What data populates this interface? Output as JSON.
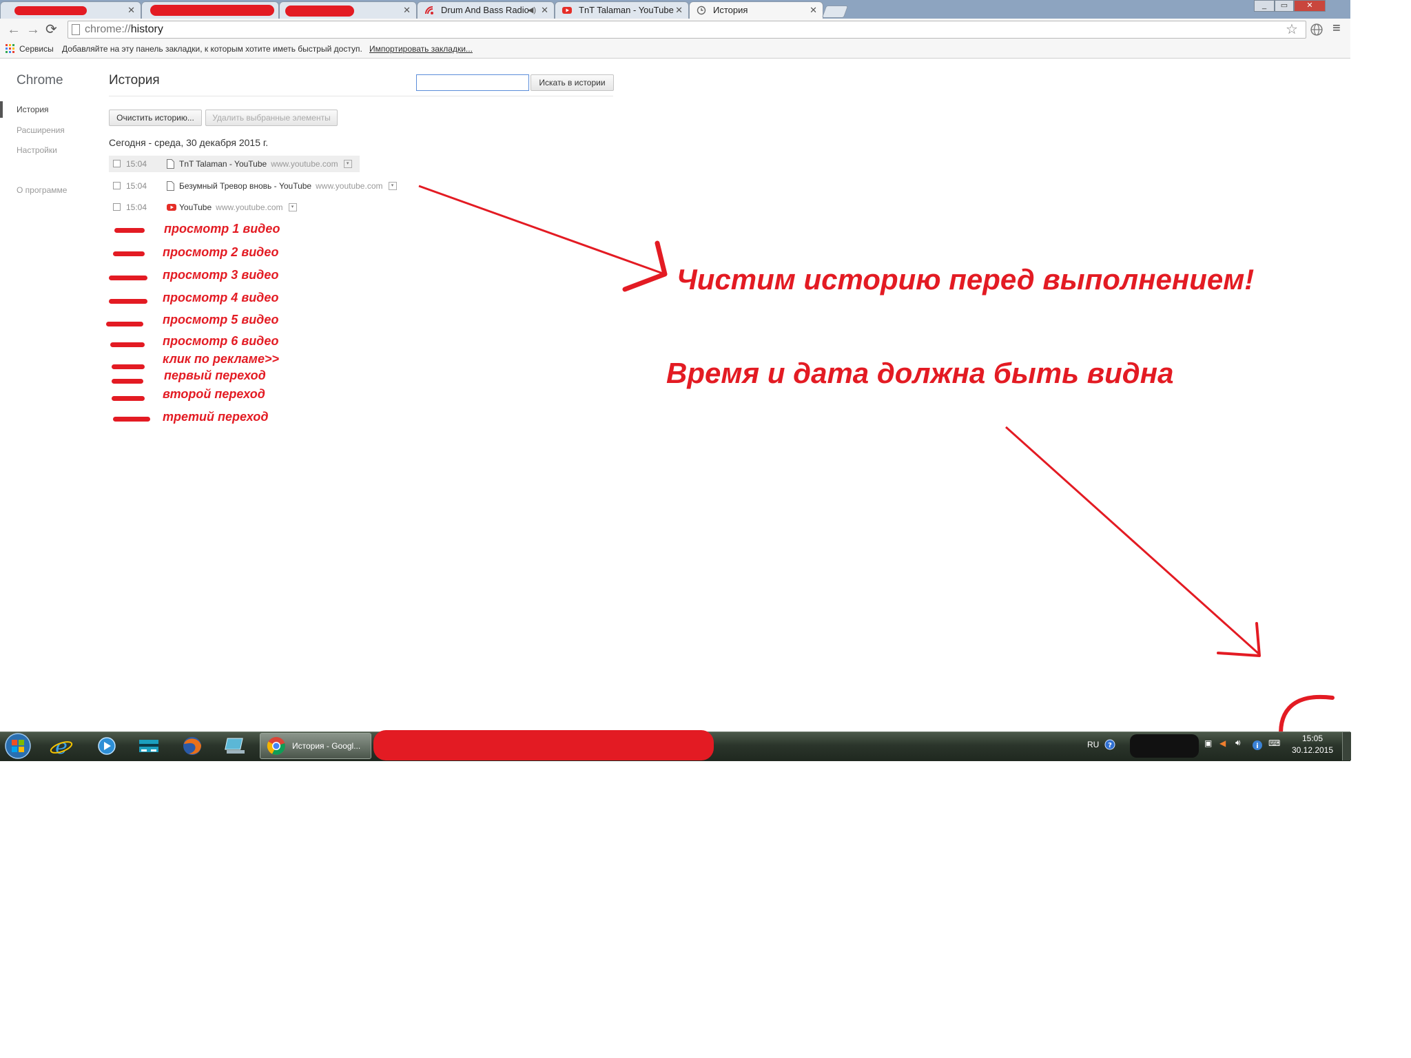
{
  "browser": {
    "tabs": [
      {
        "title": "Drum And Bass Radio",
        "icon": "radio-icon"
      },
      {
        "title": "TnT Talaman - YouTube",
        "icon": "youtube-icon"
      },
      {
        "title": "История",
        "icon": "history-icon"
      }
    ],
    "omnibox": {
      "scheme": "chrome://",
      "path": "history"
    },
    "bookmarks_bar": {
      "apps_label": "Сервисы",
      "hint": "Добавляйте на эту панель закладки, к которым хотите иметь быстрый доступ.",
      "import_link": "Импортировать закладки..."
    }
  },
  "sidebar": {
    "brand": "Chrome",
    "items": [
      {
        "label": "История"
      },
      {
        "label": "Расширения"
      },
      {
        "label": "Настройки"
      },
      {
        "label": "О программе"
      }
    ]
  },
  "history": {
    "title": "История",
    "search_button": "Искать в истории",
    "search_value": "",
    "clear_button": "Очистить историю...",
    "delete_button": "Удалить выбранные элементы",
    "day_header": "Сегодня - среда, 30 декабря 2015 г.",
    "entries": [
      {
        "time": "15:04",
        "title": "TnT Talaman - YouTube",
        "domain": "www.youtube.com"
      },
      {
        "time": "15:04",
        "title": "Безумный Тревор вновь - YouTube",
        "domain": "www.youtube.com"
      },
      {
        "time": "15:04",
        "title": "YouTube",
        "domain": "www.youtube.com"
      }
    ]
  },
  "annotations": {
    "steps": [
      "просмотр 1 видео",
      "просмотр 2 видео",
      "просмотр 3 видео",
      "просмотр 4 видео",
      "просмотр 5 видео",
      "просмотр 6 видео",
      "клик по рекламе>>",
      "первый переход",
      "второй переход",
      "третий переход"
    ],
    "main_note": "Чистим историю перед выполнением!",
    "time_note": "Время и дата должна быть видна",
    "color": "#e31b23"
  },
  "taskbar": {
    "active_window": "История - Googl...",
    "language": "RU",
    "time": "15:05",
    "date": "30.12.2015"
  }
}
